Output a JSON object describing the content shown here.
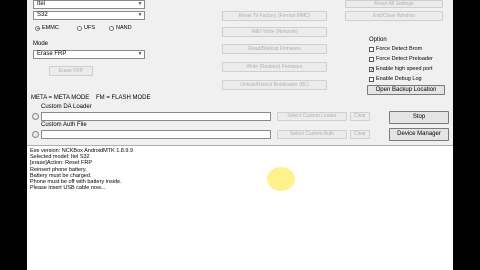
{
  "model_selector": {
    "brand_value": "Itel",
    "model_value": "S32"
  },
  "storage": {
    "options": [
      {
        "label": "EMMC",
        "selected": true
      },
      {
        "label": "UFS",
        "selected": false
      },
      {
        "label": "NAND",
        "selected": false
      }
    ]
  },
  "mode": {
    "label": "Mode",
    "value": "Erase FRP",
    "erase_button": "Erase FRP"
  },
  "center_buttons": [
    "Reset To Factory (Format MMC)",
    "IMEI Write (Network)",
    "Read/Backup Firmware",
    "Write (Restore) Firmware",
    "Unlock/Relock Bootloader (BL)"
  ],
  "right_buttons": [
    "Reset All Settings",
    "Exit/Close Window"
  ],
  "options": {
    "title": "Option",
    "items": [
      {
        "label": "Force Detect Brom",
        "checked": false
      },
      {
        "label": "Force Detect Preloader",
        "checked": false
      },
      {
        "label": "Enable high speed port",
        "checked": true
      },
      {
        "label": "Enable Debug Log",
        "checked": false
      }
    ],
    "open_backup": "Open Backup Location"
  },
  "legend": {
    "meta": "META = META MODE",
    "fm": "FM = FLASH MODE"
  },
  "custom_da": {
    "label": "Custom DA Loader",
    "value": "",
    "select_button": "Select Custom Loader",
    "clear_button": "Clear"
  },
  "custom_auth": {
    "label": "Custom Auth File",
    "value": "",
    "select_button": "Select Custom Auth",
    "clear_button": "Clear"
  },
  "actions": {
    "stop": "Stop",
    "device_manager": "Device Manager"
  },
  "log": [
    "Exe version: NCKBox AndroidMTK 1.8.9.9",
    "Selected model: Itel  S32",
    "[erase]Action: Reset FRP",
    "Reinsert phone battery.",
    "Battery must be charged.",
    "Phone must be off with battery inside.",
    "Please insert USB cable now..."
  ]
}
